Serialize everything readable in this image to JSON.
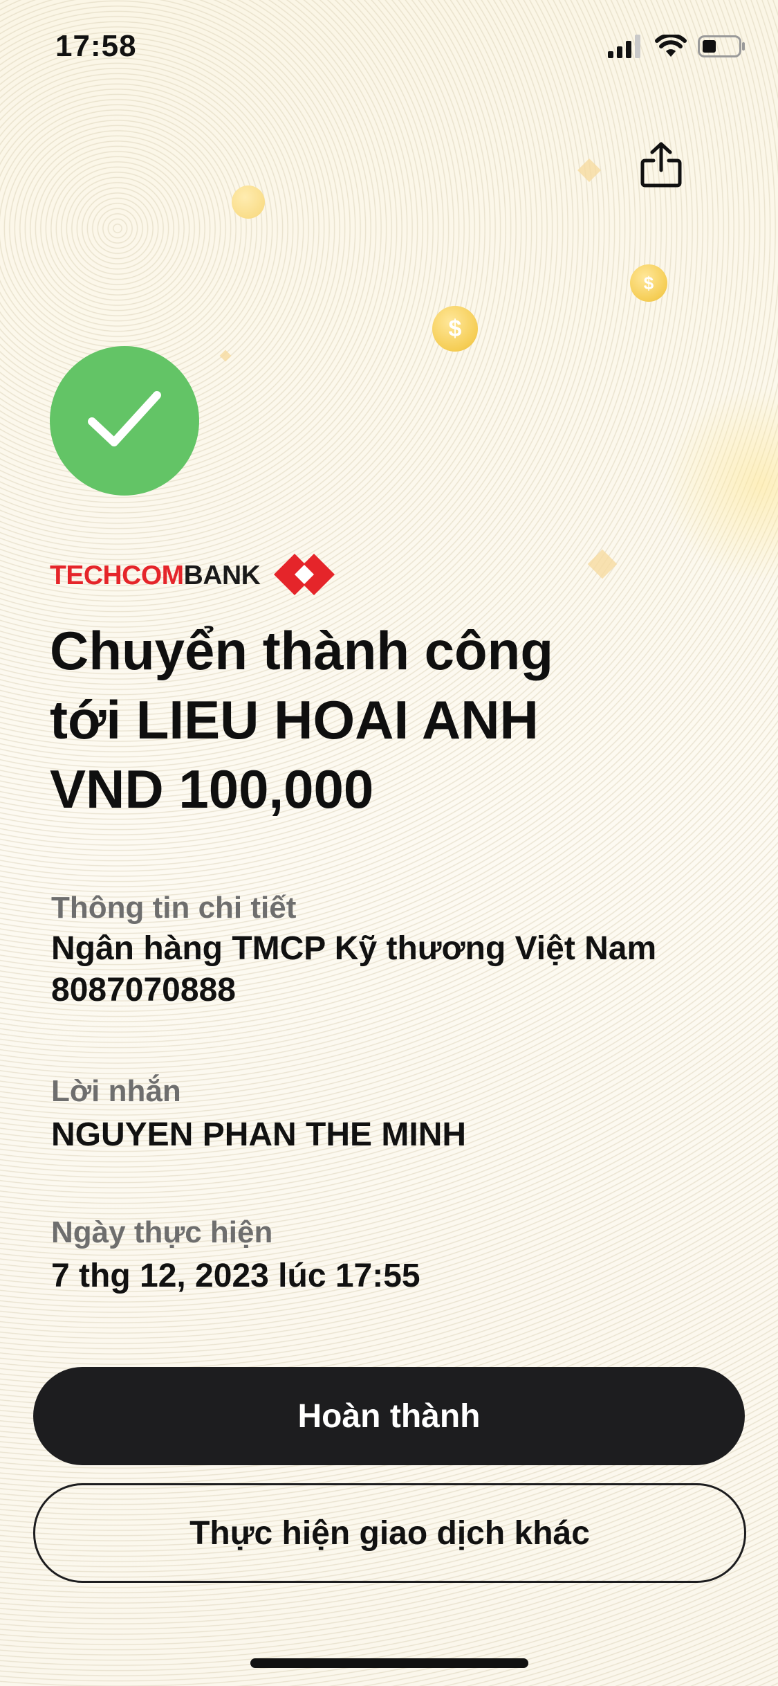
{
  "status_bar": {
    "time": "17:58"
  },
  "coins": {
    "symbol": "$"
  },
  "brand": {
    "name_red": "TECHCOM",
    "name_dark": "BANK",
    "colors": {
      "red": "#e5252a",
      "dark": "#1a1a1a"
    }
  },
  "headline": {
    "line1": "Chuyển thành công",
    "line2": "tới LIEU HOAI ANH",
    "line3": "VND 100,000"
  },
  "details": {
    "label": "Thông tin chi tiết",
    "bank": "Ngân hàng TMCP Kỹ thương Việt Nam",
    "account": "8087070888"
  },
  "message": {
    "label": "Lời nhắn",
    "value": "NGUYEN PHAN THE MINH"
  },
  "date": {
    "label": "Ngày thực hiện",
    "value": "7 thg 12, 2023 lúc 17:55"
  },
  "actions": {
    "done": "Hoàn thành",
    "another": "Thực hiện giao dịch khác"
  },
  "colors": {
    "success": "#63c466",
    "primary_button": "#1d1d1f",
    "coin": "#f5cd54"
  },
  "icons": {
    "share": "share-icon",
    "check": "checkmark-icon",
    "signal": "cellular-signal-icon",
    "wifi": "wifi-icon",
    "battery": "battery-icon"
  }
}
